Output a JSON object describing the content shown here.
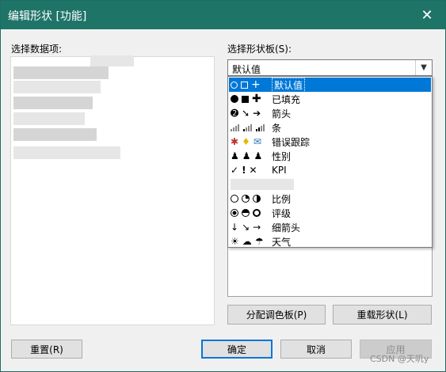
{
  "window": {
    "title": "编辑形状 [功能]",
    "close_glyph": "✕"
  },
  "left": {
    "label": "选择数据项:"
  },
  "right": {
    "label": "选择形状板(S):",
    "combo_value": "默认值",
    "items": [
      {
        "label": "默认值",
        "icons": [
          "circle-outline-icon",
          "square-outline-icon",
          "plus-icon"
        ]
      },
      {
        "label": "已填充",
        "icons": [
          "filled-circle-icon",
          "filled-square-icon",
          "filled-plus-icon"
        ]
      },
      {
        "label": "箭头",
        "icons": [
          "arrow-down-circle-icon",
          "arrow-diag-circle-icon",
          "arrow-right-circle-icon"
        ]
      },
      {
        "label": "条",
        "icons": [
          "bars-low-icon",
          "bars-mid-icon",
          "bars-high-icon"
        ]
      },
      {
        "label": "错误跟踪",
        "icons": [
          "bug-icon",
          "bulb-icon",
          "mail-icon"
        ]
      },
      {
        "label": "性别",
        "icons": [
          "person-icon",
          "person-icon",
          "person-icon"
        ]
      },
      {
        "label": "KPI",
        "icons": [
          "check-icon",
          "exclamation-icon",
          "x-icon"
        ]
      },
      {
        "label": "",
        "icons": []
      },
      {
        "label": "比例",
        "icons": [
          "circle-empty-icon",
          "circle-quarter-icon",
          "circle-half-icon"
        ]
      },
      {
        "label": "评级",
        "icons": [
          "circle-dot-icon",
          "circle-tophalf-icon",
          "circle-ring-icon"
        ]
      },
      {
        "label": "细箭头",
        "icons": [
          "thin-arrow-down-icon",
          "thin-arrow-diag-icon",
          "thin-arrow-right-icon"
        ]
      },
      {
        "label": "天气",
        "icons": [
          "sun-icon",
          "cloud-icon",
          "rain-icon"
        ]
      }
    ]
  },
  "buttons": {
    "assign_palette": "分配调色板(P)",
    "reload_shapes": "重载形状(L)",
    "reset": "重置(R)",
    "ok": "确定",
    "cancel": "取消",
    "apply": "应用"
  },
  "watermark": "CSDN @天叽y",
  "colors": {
    "titlebar": "#1f7468",
    "selection": "#0078d7"
  }
}
